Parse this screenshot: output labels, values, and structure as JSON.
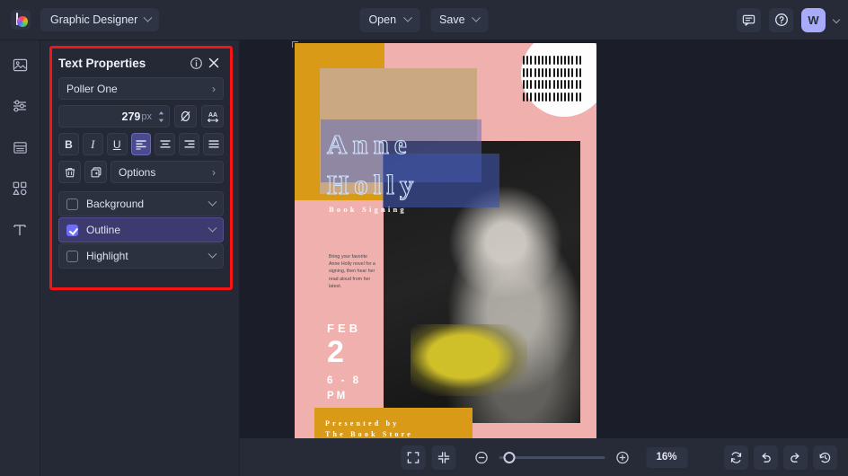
{
  "topbar": {
    "logo_icon": "app-logo-icon",
    "project_name": "Graphic Designer",
    "open_label": "Open",
    "save_label": "Save",
    "comment_icon": "comment-icon",
    "help_icon": "help-circle-icon",
    "avatar_initial": "W",
    "avatar_color": "#a7abf9"
  },
  "rail": {
    "items": [
      {
        "icon": "image-icon",
        "name": "sidebar-item-images"
      },
      {
        "icon": "adjustments-icon",
        "name": "sidebar-item-adjustments"
      },
      {
        "icon": "layers-panel-icon",
        "name": "sidebar-item-layout"
      },
      {
        "icon": "shapes-icon",
        "name": "sidebar-item-elements"
      },
      {
        "icon": "text-icon",
        "name": "sidebar-item-text"
      }
    ]
  },
  "panel": {
    "title": "Text Properties",
    "info_icon": "info-icon",
    "close_icon": "close-icon",
    "font_family": "Poller One",
    "font_size_value": "279",
    "font_size_unit": "px",
    "spinner_icon": "stepper-arrows-icon",
    "no_color_icon": "no-color-icon",
    "letter_spacing_icon": "letter-spacing-icon",
    "bold_label": "B",
    "italic_label": "I",
    "underline_label": "U",
    "align_left_icon": "align-left-icon",
    "align_center_icon": "align-center-icon",
    "align_right_icon": "align-right-icon",
    "align_justify_icon": "align-justify-icon",
    "active_alignment": "left",
    "delete_icon": "trash-icon",
    "duplicate_icon": "duplicate-icon",
    "options_label": "Options",
    "toggles": [
      {
        "label": "Background",
        "checked": false
      },
      {
        "label": "Outline",
        "checked": true
      },
      {
        "label": "Highlight",
        "checked": false
      }
    ],
    "highlight_border_color": "#f81414",
    "accent_color": "#6f6ef5"
  },
  "poster": {
    "title_line1": "Anne",
    "title_line2": "Holly",
    "subtitle": "Book Signing",
    "body": "Bring your favorite Anne Holly novel for a signing, then hear her read aloud from her latest.",
    "month": "FEB",
    "day": "2",
    "time_line1": "6 - 8",
    "time_line2": "PM",
    "banner_line1": "Presented by",
    "banner_line2": "The Book Store",
    "colors": {
      "pink": "#efb0ae",
      "yellow": "#d99a18",
      "tan": "#c9a882",
      "outline": "#cfe3ff"
    }
  },
  "bottombar": {
    "fit_screen_icon": "fit-screen-icon",
    "collapse_icon": "collapse-icon",
    "zoom_out_icon": "zoom-out-icon",
    "zoom_in_icon": "zoom-in-icon",
    "zoom_level": "16%",
    "sync_icon": "sync-icon",
    "undo_icon": "undo-icon",
    "redo_icon": "redo-icon",
    "history_icon": "history-icon"
  }
}
